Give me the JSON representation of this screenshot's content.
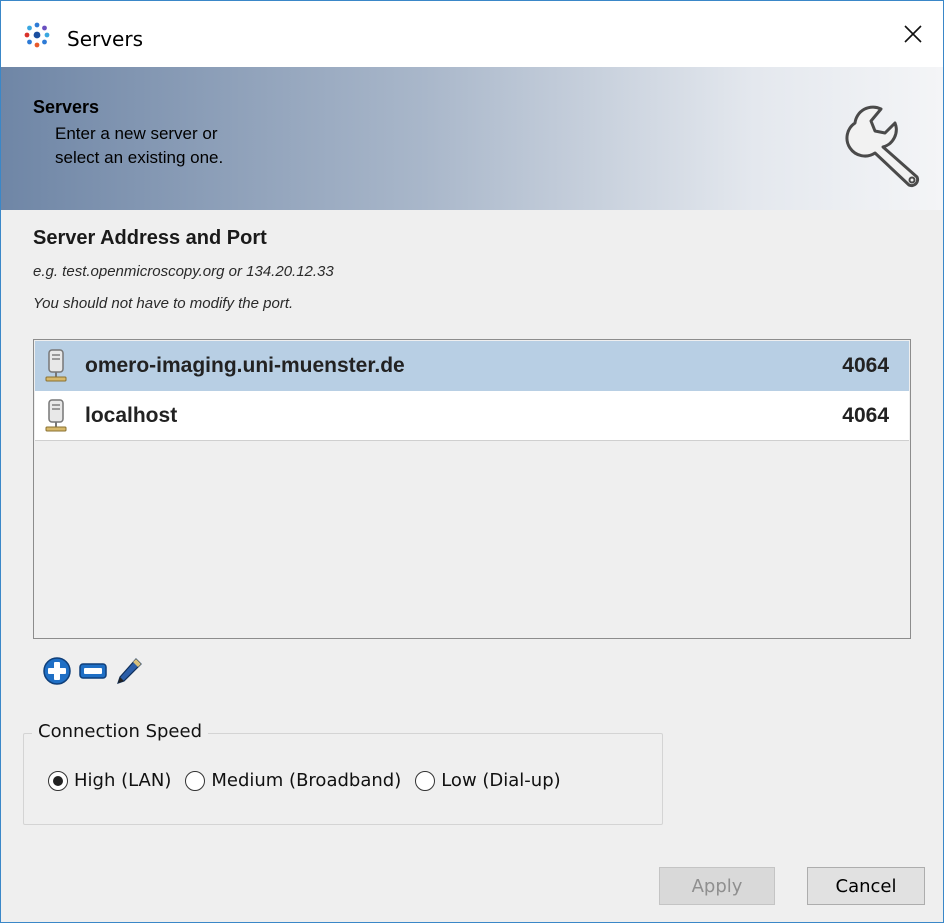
{
  "window": {
    "title": "Servers"
  },
  "banner": {
    "title": "Servers",
    "subtitle_line1": "Enter a new server or",
    "subtitle_line2": "select an existing one."
  },
  "address": {
    "title": "Server Address and Port",
    "hint1": "e.g. test.openmicroscopy.org or 134.20.12.33",
    "hint2": "You should not have to modify the port."
  },
  "servers": [
    {
      "name": "omero-imaging.uni-muenster.de",
      "port": "4064",
      "selected": true
    },
    {
      "name": "localhost",
      "port": "4064",
      "selected": false
    }
  ],
  "toolbar": {
    "add_icon": "plus-icon",
    "remove_icon": "minus-icon",
    "edit_icon": "pencil-icon"
  },
  "connection_speed": {
    "label": "Connection Speed",
    "options": [
      "High (LAN)",
      "Medium (Broadband)",
      "Low (Dial-up)"
    ],
    "selected": "High (LAN)"
  },
  "buttons": {
    "apply": "Apply",
    "cancel": "Cancel",
    "apply_enabled": false
  },
  "colors": {
    "selection": "#b8cfe4",
    "accent_blue": "#1f6fc5",
    "window_border": "#3a87c8"
  }
}
